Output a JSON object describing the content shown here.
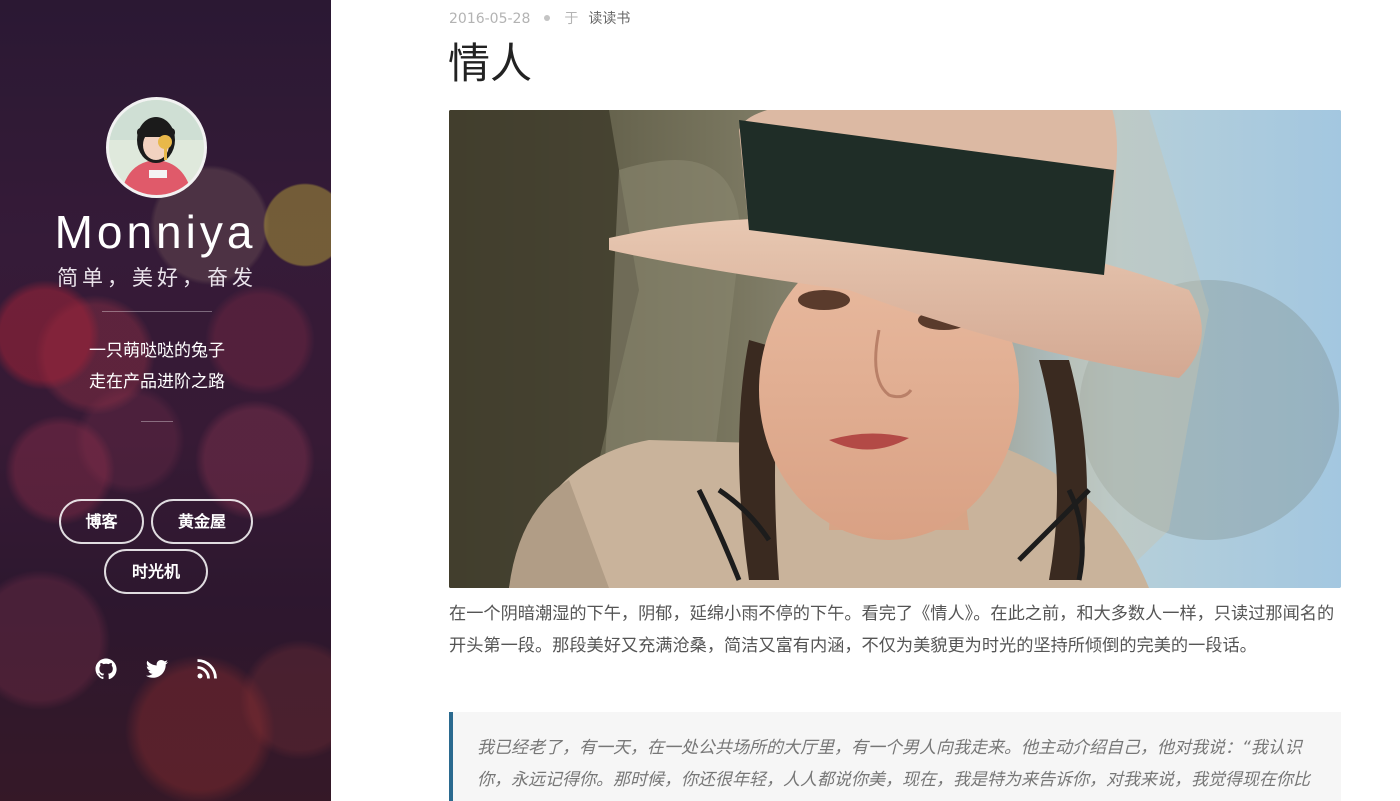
{
  "sidebar": {
    "site_name": "Monniya",
    "motto": "简单，美好，奋发",
    "bio_line1": "一只萌哒哒的兔子",
    "bio_line2": "走在产品进阶之路",
    "nav": [
      {
        "label": "博客"
      },
      {
        "label": "黄金屋"
      },
      {
        "label": "时光机"
      }
    ],
    "social": [
      "github-icon",
      "twitter-icon",
      "rss-icon"
    ]
  },
  "post": {
    "date": "2016-05-28",
    "in_label": "于",
    "category": "读读书",
    "title": "情人",
    "paragraph": "在一个阴暗潮湿的下午，阴郁，延绵小雨不停的下午。看完了《情人》。在此之前，和大多数人一样，只读过那闻名的开头第一段。那段美好又充满沧桑，简洁又富有内涵，不仅为美貌更为时光的坚持所倾倒的完美的一段话。",
    "quote": "我已经老了，有一天，在一处公共场所的大厅里，有一个男人向我走来。他主动介绍自己，他对我说：“我认识你，永远记得你。那时候，你还很年轻，人人都说你美，现在，我是特为来告诉你，对我来说，我觉得现在你比年轻的时候更美，那时你是年轻女人，与你那时的面貌相比，我更爱你现在备受摧残的面容。”"
  },
  "colors": {
    "quote_border": "#2b6a8f",
    "sidebar_bg": "#3a1e3c"
  }
}
